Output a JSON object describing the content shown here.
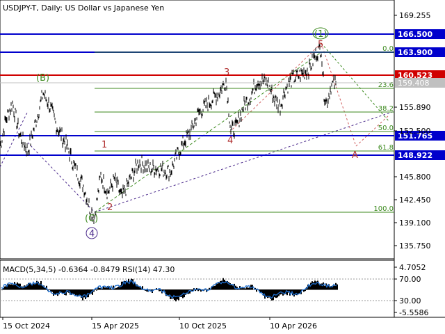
{
  "chart_data": [
    {
      "type": "line",
      "title": "USDJPY-T, Daily:  US Dollar vs Japanese Yen",
      "ylim": [
        133.0,
        171.5
      ],
      "y_ticks": [
        "169.255",
        "166.500",
        "163.900",
        "160.523",
        "159.408",
        "155.890",
        "152.500",
        "151.765",
        "148.922",
        "145.800",
        "142.450",
        "139.100",
        "135.750"
      ],
      "x_ticks": [
        "15 Oct 2024",
        "15 Apr 2025",
        "10 Oct 2025",
        "10 Apr 2026"
      ],
      "current_price": "159.408",
      "key_levels": [
        {
          "label": "166.500",
          "value": 166.5,
          "color": "#0000cc"
        },
        {
          "label": "163.900",
          "value": 163.9,
          "color": "#0000cc"
        },
        {
          "label": "160.523",
          "value": 160.523,
          "color": "#d00000"
        },
        {
          "label": "151.765",
          "value": 151.765,
          "color": "#0000cc"
        },
        {
          "label": "148.922",
          "value": 148.922,
          "color": "#0000cc"
        }
      ],
      "fibonacci": [
        {
          "label": "0.0",
          "value": 163.9
        },
        {
          "label": "23.6",
          "value": 158.6
        },
        {
          "label": "38.2",
          "value": 155.2
        },
        {
          "label": "50.0",
          "value": 152.4
        },
        {
          "label": "61.8",
          "value": 149.5
        },
        {
          "label": "100.0",
          "value": 140.6
        }
      ],
      "wave_labels": [
        {
          "text": "(1)",
          "style": "green"
        },
        {
          "text": "5",
          "style": "red"
        },
        {
          "text": "3",
          "style": "red"
        },
        {
          "text": "4",
          "style": "red"
        },
        {
          "text": "1",
          "style": "red"
        },
        {
          "text": "2",
          "style": "red"
        },
        {
          "text": "(B)",
          "style": "green"
        },
        {
          "text": "(C)",
          "style": "green"
        },
        {
          "text": "4",
          "style": "purple"
        },
        {
          "text": "A",
          "style": "red"
        }
      ],
      "price_path": [
        [
          0,
          150.0
        ],
        [
          8,
          154.0
        ],
        [
          18,
          156.5
        ],
        [
          28,
          152.0
        ],
        [
          40,
          149.5
        ],
        [
          52,
          154.0
        ],
        [
          62,
          158.0
        ],
        [
          72,
          156.0
        ],
        [
          82,
          153.0
        ],
        [
          95,
          150.5
        ],
        [
          108,
          147.0
        ],
        [
          120,
          144.5
        ],
        [
          130,
          141.0
        ],
        [
          136,
          140.0
        ],
        [
          145,
          146.0
        ],
        [
          155,
          143.5
        ],
        [
          165,
          145.5
        ],
        [
          175,
          142.8
        ],
        [
          190,
          146.0
        ],
        [
          200,
          148.0
        ],
        [
          215,
          147.0
        ],
        [
          230,
          147.0
        ],
        [
          245,
          146.5
        ],
        [
          255,
          149.0
        ],
        [
          265,
          151.0
        ],
        [
          275,
          152.5
        ],
        [
          285,
          155.0
        ],
        [
          295,
          156.0
        ],
        [
          305,
          157.0
        ],
        [
          315,
          158.0
        ],
        [
          325,
          159.8
        ],
        [
          332,
          152.5
        ],
        [
          340,
          153.0
        ],
        [
          350,
          156.0
        ],
        [
          360,
          157.5
        ],
        [
          370,
          159.8
        ],
        [
          385,
          159.5
        ],
        [
          395,
          157.0
        ],
        [
          403,
          156.0
        ],
        [
          410,
          158.5
        ],
        [
          420,
          160.0
        ],
        [
          430,
          160.5
        ],
        [
          445,
          161.5
        ],
        [
          455,
          163.8
        ],
        [
          462,
          164.5
        ],
        [
          466,
          158.0
        ],
        [
          470,
          156.5
        ],
        [
          476,
          159.0
        ],
        [
          483,
          159.4
        ]
      ]
    },
    {
      "type": "bar",
      "title": "MACD(5,34,5) -0.6364 -0.8479 RSI(14) 47.30",
      "y_ticks": [
        "4.7052",
        "70.00",
        "30.00",
        "-5.5586"
      ]
    }
  ]
}
